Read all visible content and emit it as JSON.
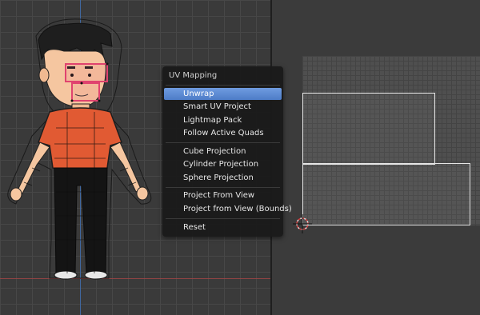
{
  "menu": {
    "title": "UV Mapping",
    "groups": [
      [
        {
          "label": "Unwrap",
          "active": true
        },
        {
          "label": "Smart UV Project"
        },
        {
          "label": "Lightmap Pack"
        },
        {
          "label": "Follow Active Quads"
        }
      ],
      [
        {
          "label": "Cube Projection"
        },
        {
          "label": "Cylinder Projection"
        },
        {
          "label": "Sphere Projection"
        }
      ],
      [
        {
          "label": "Project From View"
        },
        {
          "label": "Project from View (Bounds)"
        }
      ],
      [
        {
          "label": "Reset"
        }
      ]
    ]
  },
  "colors": {
    "accent": "#5680c2",
    "selection": "#e0436f",
    "shirt": "#e15a33",
    "skin": "#f5c6a0",
    "hair": "#1e1e1e"
  }
}
